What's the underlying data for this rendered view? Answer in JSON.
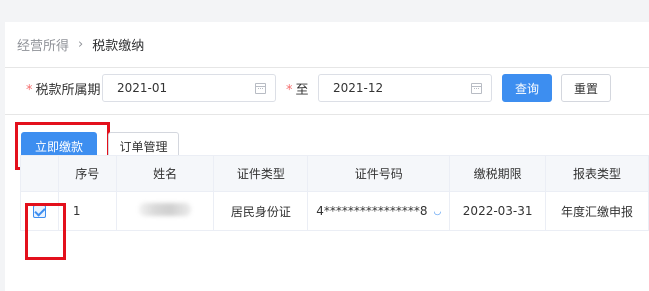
{
  "breadcrumb": {
    "parent": "经营所得",
    "separator": "›",
    "current": "税款缴纳"
  },
  "filters": {
    "period_label": "税款所属期",
    "required_mark": "*",
    "start_value": "2021-01",
    "to_label": "至",
    "end_value": "2021-12",
    "query_label": "查询",
    "reset_label": "重置"
  },
  "actions": {
    "pay_now": "立即缴款",
    "order_manage": "订单管理"
  },
  "table": {
    "headers": [
      "序号",
      "姓名",
      "证件类型",
      "证件号码",
      "缴税期限",
      "报表类型"
    ],
    "rows": [
      {
        "checked": true,
        "index": "1",
        "name": "",
        "id_type": "居民身份证",
        "id_number": "4****************8",
        "deadline": "2022-03-31",
        "report_type": "年度汇缴申报"
      }
    ]
  },
  "colors": {
    "primary": "#3d8ef0",
    "highlight": "#e3101c",
    "required": "#f56c6c"
  }
}
